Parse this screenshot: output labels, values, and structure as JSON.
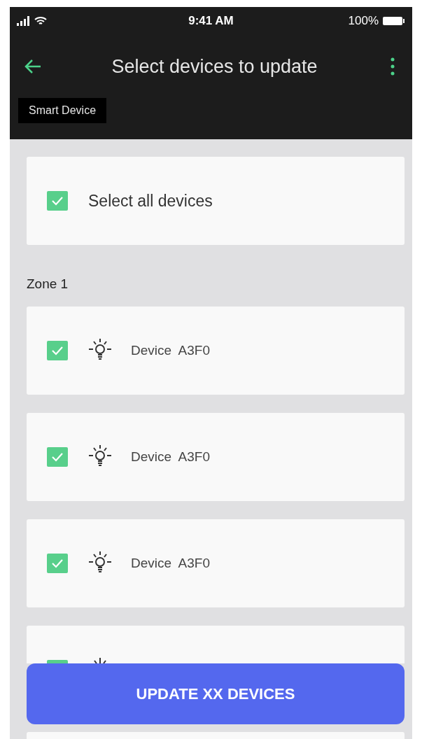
{
  "status_bar": {
    "time": "9:41 AM",
    "battery": "100%"
  },
  "header": {
    "title": "Select devices to update"
  },
  "tab": {
    "label": "Smart Device"
  },
  "select_all": {
    "label": "Select all devices",
    "checked": true
  },
  "zones": [
    {
      "label": "Zone 1",
      "devices": [
        {
          "name": "Device  A3F0",
          "checked": true
        },
        {
          "name": "Device  A3F0",
          "checked": true
        },
        {
          "name": "Device  A3F0",
          "checked": true
        },
        {
          "checked": true
        }
      ]
    }
  ],
  "update_button": {
    "label": "UPDATE XX DEVICES"
  }
}
